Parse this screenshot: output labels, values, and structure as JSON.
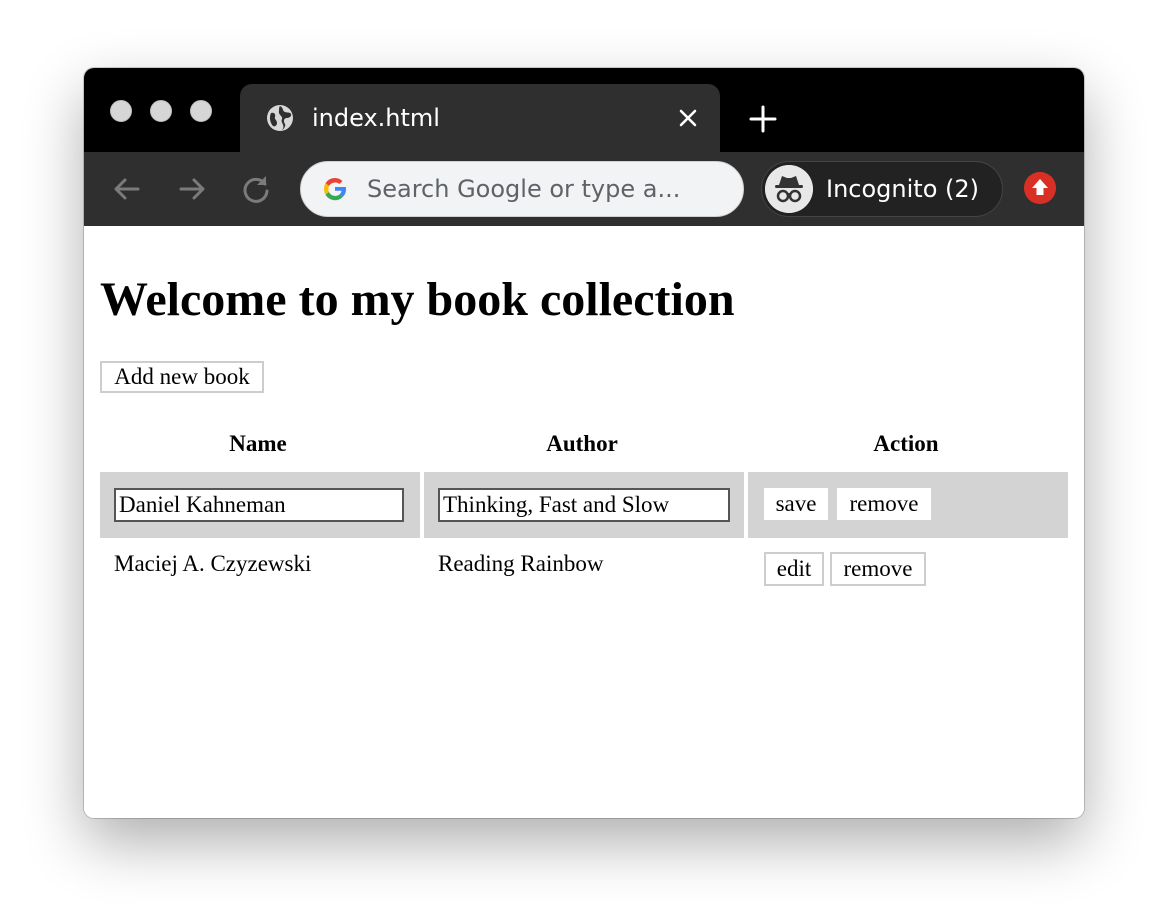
{
  "browser": {
    "tab": {
      "title": "index.html",
      "favicon": "globe-icon"
    },
    "omnibox": {
      "placeholder": "Search Google or type a...",
      "engine_icon": "google-icon"
    },
    "incognito": {
      "label": "Incognito (2)",
      "icon": "incognito-icon"
    },
    "update_icon": "update-arrow-icon",
    "colors": {
      "tabstrip": "#000000",
      "toolbar": "#2f2f2f",
      "update": "#d93025"
    }
  },
  "page": {
    "title": "Welcome to my book collection",
    "add_button": "Add new book",
    "table": {
      "headers": [
        "Name",
        "Author",
        "Action"
      ],
      "editing_row": {
        "name_value": "Daniel Kahneman",
        "author_value": "Thinking, Fast and Slow",
        "save_label": "save",
        "remove_label": "remove"
      },
      "rows": [
        {
          "name": "Maciej A. Czyzewski",
          "author": "Reading Rainbow",
          "edit_label": "edit",
          "remove_label": "remove"
        }
      ]
    },
    "colors": {
      "editing_row_bg": "#d3d3d3"
    }
  }
}
